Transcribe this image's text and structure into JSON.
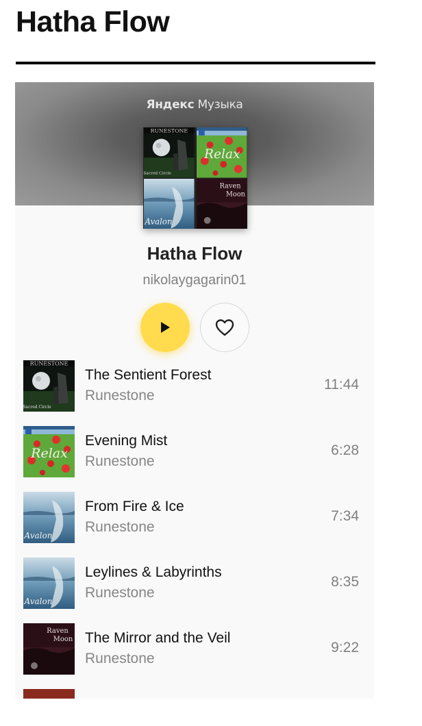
{
  "page": {
    "title": "Hatha Flow"
  },
  "widget": {
    "brand": {
      "bold": "Яндекс",
      "regular": "Музыка"
    },
    "playlist_title": "Hatha Flow",
    "owner": "nikolaygagarin01",
    "accent_color": "#ffdb4d",
    "cover_text": {
      "runestone": "RUNESTONE",
      "sacred_circle": "Sacred Circle",
      "relax": "Relax",
      "raven": "Raven",
      "moon": "Moon",
      "avalon": "Avalon"
    },
    "tracks": [
      {
        "title": "The Sentient Forest",
        "artist": "Runestone",
        "duration": "11:44",
        "cover": "sacred-circle"
      },
      {
        "title": "Evening Mist",
        "artist": "Runestone",
        "duration": "6:28",
        "cover": "relax"
      },
      {
        "title": "From Fire & Ice",
        "artist": "Runestone",
        "duration": "7:34",
        "cover": "avalon"
      },
      {
        "title": "Leylines & Labyrinths",
        "artist": "Runestone",
        "duration": "8:35",
        "cover": "avalon"
      },
      {
        "title": "The Mirror and the Veil",
        "artist": "Runestone",
        "duration": "9:22",
        "cover": "raven-moon"
      }
    ]
  }
}
